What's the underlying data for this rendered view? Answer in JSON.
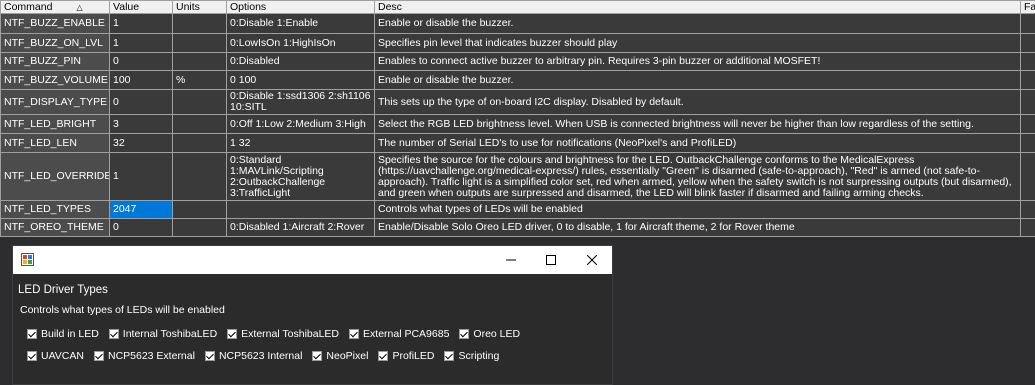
{
  "grid": {
    "headers": {
      "command": "Command",
      "value": "Value",
      "units": "Units",
      "options": "Options",
      "desc": "Desc",
      "extra": "Fa"
    },
    "rows": [
      {
        "command": "NTF_BUZZ_ENABLE",
        "value": "1",
        "units": "",
        "options": "0:Disable 1:Enable",
        "desc": "Enable or disable the buzzer."
      },
      {
        "command": "NTF_BUZZ_ON_LVL",
        "value": "1",
        "units": "",
        "options": "0:LowIsOn 1:HighIsOn",
        "desc": "Specifies pin level that indicates buzzer should play"
      },
      {
        "command": "NTF_BUZZ_PIN",
        "value": "0",
        "units": "",
        "options": "0:Disabled",
        "desc": "Enables to connect active buzzer to arbitrary pin. Requires 3-pin buzzer or additional MOSFET!"
      },
      {
        "command": "NTF_BUZZ_VOLUME",
        "value": "100",
        "units": "%",
        "options": "0 100",
        "desc": "Enable or disable the buzzer."
      },
      {
        "command": "NTF_DISPLAY_TYPE",
        "value": "0",
        "units": "",
        "options": "0:Disable 1:ssd1306 2:sh1106 10:SITL",
        "desc": "This sets up the type of on-board I2C display. Disabled by default."
      },
      {
        "command": "NTF_LED_BRIGHT",
        "value": "3",
        "units": "",
        "options": "0:Off 1:Low 2:Medium 3:High",
        "desc": "Select the RGB LED brightness level. When USB is connected brightness will never be higher than low regardless of the setting."
      },
      {
        "command": "NTF_LED_LEN",
        "value": "32",
        "units": "",
        "options": "1 32",
        "desc": "The number of Serial LED's to use for notifications (NeoPixel's and ProfiLED)"
      },
      {
        "command": "NTF_LED_OVERRIDE",
        "value": "1",
        "units": "",
        "options": "0:Standard 1:MAVLink/Scripting 2:OutbackChallenge 3:TrafficLight",
        "desc": "Specifies the source for the colours and brightness for the LED.  OutbackChallenge conforms to the MedicalExpress (https://uavchallenge.org/medical-express/) rules, essentially \"Green\" is disarmed (safe-to-approach), \"Red\" is armed (not safe-to-approach). Traffic light is a simplified color set, red when armed, yellow when the safety switch is not surpressing outputs (but disarmed), and green when outputs are surpressed and disarmed, the LED will blink faster if disarmed and failing arming checks."
      },
      {
        "command": "NTF_LED_TYPES",
        "value": "2047",
        "units": "",
        "options": "",
        "desc": "Controls what types of LEDs will be enabled"
      },
      {
        "command": "NTF_OREO_THEME",
        "value": "0",
        "units": "",
        "options": "0:Disabled 1:Aircraft 2:Rover",
        "desc": "Enable/Disable Solo Oreo LED driver, 0 to disable, 1 for Aircraft theme, 2 for Rover theme"
      }
    ]
  },
  "dialog": {
    "title": "LED Driver Types",
    "subtitle": "Controls what types of LEDs will be enabled",
    "row1": [
      "Build in LED",
      "Internal ToshibaLED",
      "External ToshibaLED",
      "External PCA9685",
      "Oreo LED"
    ],
    "row2": [
      "UAVCAN",
      "NCP5623 External",
      "NCP5623 Internal",
      "NeoPixel",
      "ProfiLED",
      "Scripting"
    ],
    "minimize_icon": "minimize-icon",
    "maximize_icon": "maximize-icon",
    "close_icon": "close-icon"
  },
  "colors": {
    "selection": "#0078d7",
    "background": "#2d2d30"
  }
}
